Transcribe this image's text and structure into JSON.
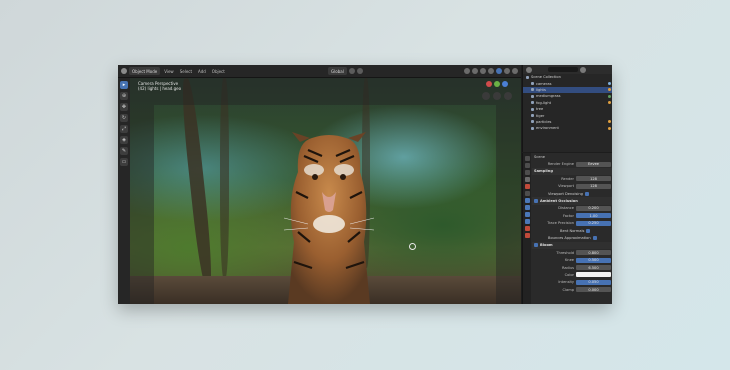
{
  "header": {
    "mode": "Object Mode",
    "menus": [
      "View",
      "Select",
      "Add",
      "Object"
    ],
    "shading_label": "Global"
  },
  "viewport": {
    "camera_label": "Camera Perspective",
    "scene_label": "(42) lights | head.geo"
  },
  "toolbar": {
    "tools": [
      "select",
      "cursor",
      "move",
      "rotate",
      "scale",
      "transform",
      "annotate",
      "measure"
    ]
  },
  "outliner": {
    "rows": [
      {
        "label": "Scene Collection",
        "selected": false
      },
      {
        "label": "cameras",
        "selected": false
      },
      {
        "label": "lights",
        "selected": true
      },
      {
        "label": "mediumgrass",
        "selected": false
      },
      {
        "label": "fog-light",
        "selected": false
      },
      {
        "label": "tree",
        "selected": false
      },
      {
        "label": "tiger",
        "selected": false
      },
      {
        "label": "particles",
        "selected": false
      },
      {
        "label": "environment",
        "selected": false
      }
    ]
  },
  "properties": {
    "scene_name": "Scene",
    "render_engine_label": "Render Engine",
    "render_engine": "Eevee",
    "sampling": {
      "title": "Sampling",
      "render_label": "Render",
      "render_value": "128",
      "viewport_label": "Viewport",
      "viewport_value": "128",
      "denoise_label": "Viewport Denoising"
    },
    "ao": {
      "title": "Ambient Occlusion",
      "distance_label": "Distance",
      "distance_value": "0.200",
      "factor_label": "Factor",
      "factor_value": "1.00",
      "trace_label": "Trace Precision",
      "trace_value": "0.250",
      "bent_normals": "Bent Normals",
      "bounces": "Bounces Approximation"
    },
    "bloom": {
      "title": "Bloom",
      "threshold_label": "Threshold",
      "threshold_value": "0.800",
      "knee_label": "Knee",
      "knee_value": "0.500",
      "radius_label": "Radius",
      "radius_value": "6.500",
      "color_label": "Color",
      "intensity_label": "Intensity",
      "intensity_value": "0.050",
      "clamp_label": "Clamp",
      "clamp_value": "0.000"
    }
  },
  "colors": {
    "accent": "#4772b3",
    "panel": "#262626",
    "selection": "#334d80"
  }
}
